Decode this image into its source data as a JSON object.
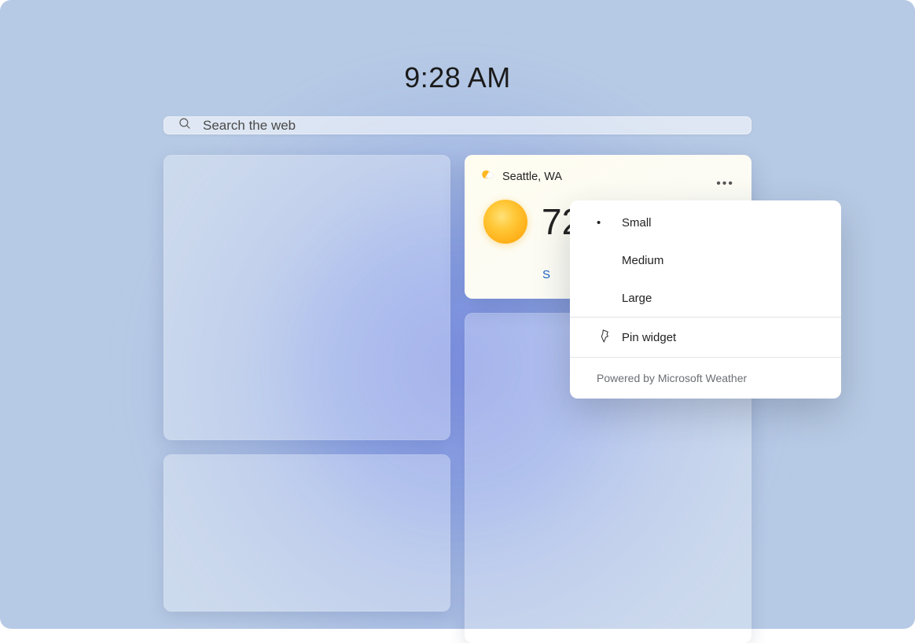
{
  "clock": "9:28 AM",
  "search": {
    "placeholder": "Search the web"
  },
  "weather": {
    "location": "Seattle, WA",
    "temp": "72",
    "link_text_visible": "S"
  },
  "context_menu": {
    "sizes": [
      {
        "label": "Small",
        "selected": true
      },
      {
        "label": "Medium",
        "selected": false
      },
      {
        "label": "Large",
        "selected": false
      }
    ],
    "pin_label": "Pin widget",
    "footer": "Powered by Microsoft Weather"
  }
}
